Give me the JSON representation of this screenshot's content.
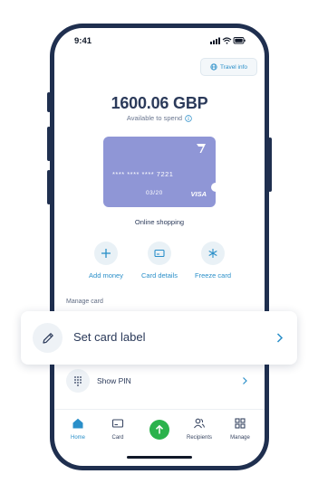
{
  "status_bar": {
    "time": "9:41"
  },
  "travel_info": {
    "label": "Travel info",
    "icon": "globe-icon"
  },
  "balance": {
    "amount": "1600.06 GBP",
    "caption": "Available to spend"
  },
  "card": {
    "number": "**** **** **** 7221",
    "expiry": "03/20",
    "network": "VISA",
    "caption": "Online shopping",
    "color": "#8f96d6"
  },
  "actions": [
    {
      "label": "Add money",
      "icon": "plus-icon"
    },
    {
      "label": "Card details",
      "icon": "card-icon"
    },
    {
      "label": "Freeze card",
      "icon": "snowflake-icon"
    }
  ],
  "manage": {
    "section_label": "Manage card",
    "set_label": {
      "label": "Set card label",
      "icon": "pencil-icon"
    },
    "show_pin": {
      "label": "Show PIN",
      "icon": "keypad-icon"
    }
  },
  "nav": {
    "items": [
      {
        "label": "Home",
        "icon": "home-icon",
        "active": true
      },
      {
        "label": "Card",
        "icon": "card-icon"
      },
      {
        "label": "Recipients",
        "icon": "recipients-icon"
      },
      {
        "label": "Manage",
        "icon": "grid-icon"
      }
    ],
    "send_icon": "arrow-up-icon"
  },
  "colors": {
    "accent": "#2a8fc9",
    "send": "#2bb24c",
    "frame": "#1f2f4f",
    "text": "#2b3a5a"
  }
}
